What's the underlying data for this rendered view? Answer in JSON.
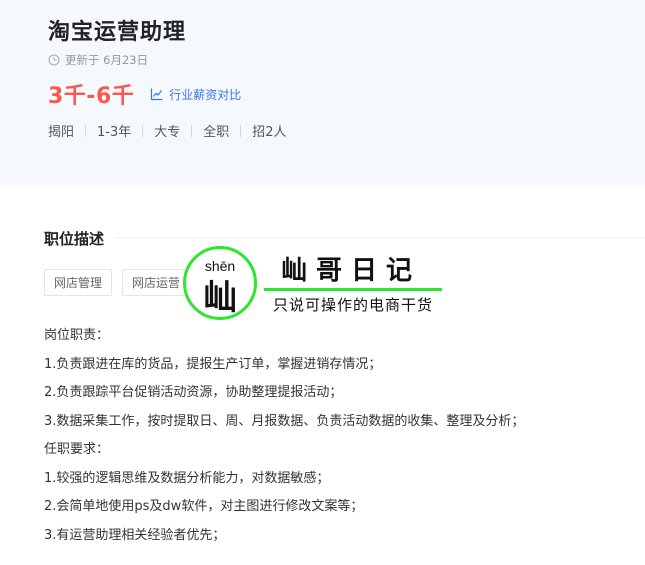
{
  "job": {
    "title": "淘宝运营助理",
    "updated": "更新于 6月23日",
    "salary": "3千-6千",
    "compare_link": "行业薪资对比",
    "tags": [
      "揭阳",
      "1-3年",
      "大专",
      "全职",
      "招2人"
    ]
  },
  "description": {
    "section_title": "职位描述",
    "skill_tags": [
      "网店管理",
      "网店运营"
    ],
    "lines": [
      "岗位职责：",
      "1.负责跟进在库的货品，提报生产订单，掌握进销存情况；",
      "2.负责跟踪平台促销活动资源，协助整理提报活动；",
      "3.数据采集工作，按时提取日、周、月报数据、负责活动数据的收集、整理及分析；",
      "任职要求：",
      "1.较强的逻辑思维及数据分析能力，对数据敏感；",
      "2.会简单地使用ps及dw软件，对主图进行修改文案等；",
      "3.有运营助理相关经验者优先；"
    ]
  },
  "watermark": {
    "pinyin": "shēn",
    "character": "屾",
    "brand": "屾哥日记",
    "slogan": "只说可操作的电商干货"
  },
  "colors": {
    "salary": "#fe574a",
    "link": "#3a74e6",
    "watermark_green": "#2ee62e",
    "header_bg": "#f5f9fd"
  },
  "icons": {
    "updated": "clock-icon",
    "compare": "line-chart-icon"
  }
}
